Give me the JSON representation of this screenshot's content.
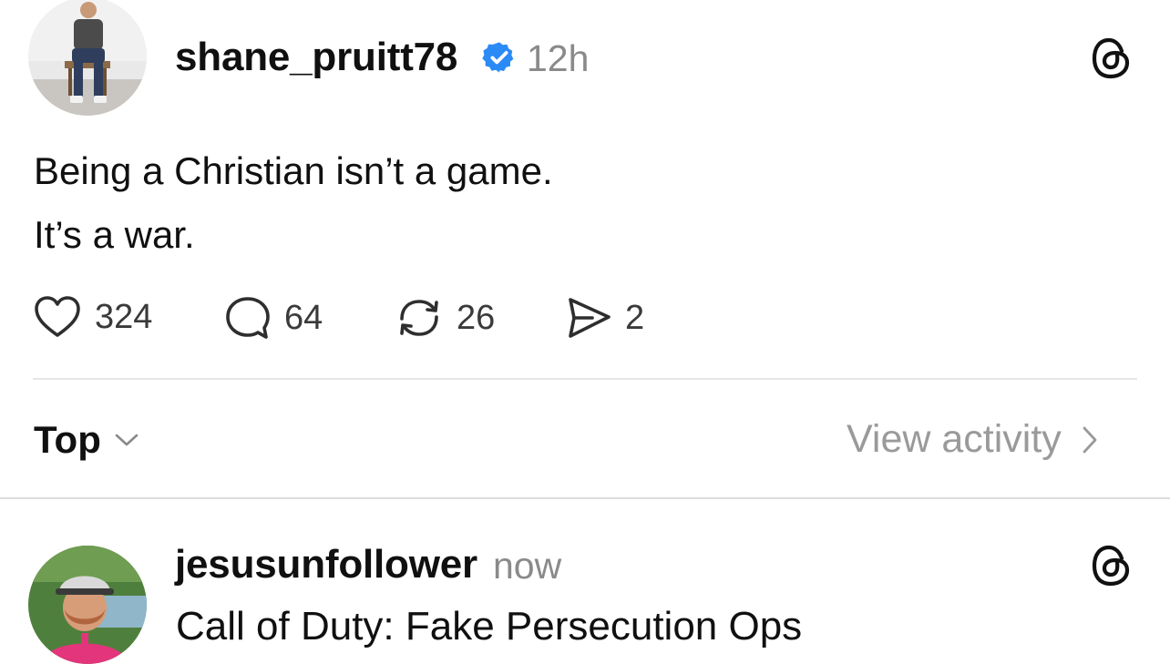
{
  "post": {
    "author": {
      "username": "shane_pruitt78",
      "verified": true,
      "verified_icon": "verified-badge-icon",
      "avatar_icon": "avatar-photo"
    },
    "time": "12h",
    "lines": [
      "Being a Christian isn’t a game.",
      "It’s a war."
    ],
    "actions": {
      "likes": "324",
      "comments": "64",
      "reposts": "26",
      "shares": "2"
    }
  },
  "thread_controls": {
    "sort_label": "Top",
    "view_activity_label": "View activity"
  },
  "reply": {
    "author": {
      "username": "jesusunfollower",
      "avatar_icon": "avatar-photo"
    },
    "time": "now",
    "text": "Call of Duty: Fake Persecution Ops"
  },
  "colors": {
    "verified_blue": "#2a8af6",
    "muted_text": "#8a8a8a",
    "divider": "#e6e6e6"
  }
}
